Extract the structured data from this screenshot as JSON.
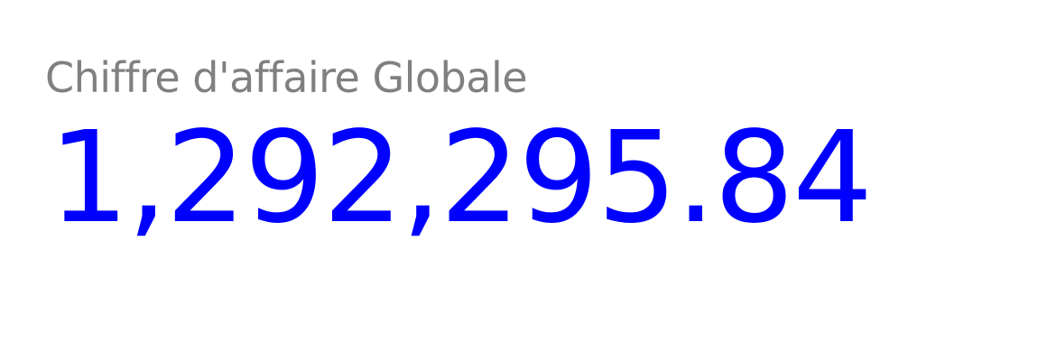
{
  "kpi": {
    "title": "Chiffre d'affaire Globale",
    "value": "1,292,295.84"
  },
  "colors": {
    "title": "#808080",
    "value": "#0000ff",
    "background": "#ffffff"
  }
}
